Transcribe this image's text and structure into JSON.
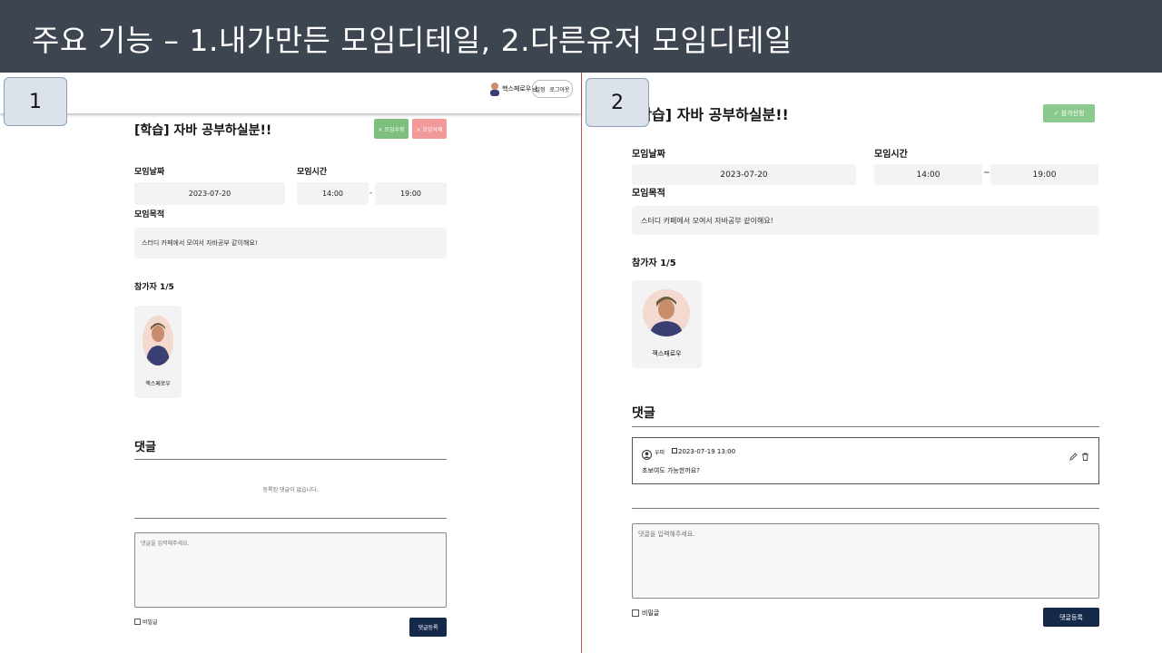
{
  "slide_title": "주요 기능 – 1.내가만든 모임디테일, 2.다른유저 모임디테일",
  "panel1": {
    "number": "1",
    "nav": {
      "username": "핵스페로우님",
      "settings": "설정",
      "logout": "로그아웃"
    },
    "title": "[학습] 자바 공부하실분!!",
    "edit_button": "× 모임수정",
    "delete_button": "× 모임삭제",
    "date_label": "모임날짜",
    "date_value": "2023-07-20",
    "time_label": "모임시간",
    "time_start": "14:00",
    "time_sep": "-",
    "time_end": "19:00",
    "purpose_label": "모임목적",
    "purpose_value": "스터디 카페에서 모여서 자바공부 같이해요!",
    "participants_label": "참가자 1/5",
    "participant_name": "잭스페로우",
    "comments_title": "댓글",
    "no_comments": "등록된 댓글이 없습니다.",
    "comment_placeholder": "댓글을 입력해주세요.",
    "secret_label": "비밀글",
    "submit_button": "댓글등록"
  },
  "panel2": {
    "number": "2",
    "title": "[학습] 자바 공부하실분!!",
    "join_button": "✓ 참가신청",
    "date_label": "모임날짜",
    "date_value": "2023-07-20",
    "time_label": "모임시간",
    "time_start": "14:00",
    "time_sep": "~",
    "time_end": "19:00",
    "purpose_label": "모임목적",
    "purpose_value": "스터디 카페에서 모여서 자바공부 같이해요!",
    "participants_label": "참가자 1/5",
    "participant_name": "잭스패로우",
    "comments_title": "댓글",
    "comment": {
      "author": "우피",
      "date": "2023-07-19 13:00",
      "text": "초보여도 가능한까요?"
    },
    "comment_placeholder": "댓글을 입력해주세요.",
    "secret_label": "비밀글",
    "submit_button": "댓글등록"
  },
  "colors": {
    "header": "#3d4550",
    "edit": "#7dbf7d",
    "delete": "#f29a9a",
    "submit": "#15294b",
    "join": "#8cc98c",
    "divider": "#c0504d"
  },
  "icons": [
    "user-icon",
    "edit-icon",
    "delete-icon",
    "calendar-icon",
    "check-icon"
  ]
}
